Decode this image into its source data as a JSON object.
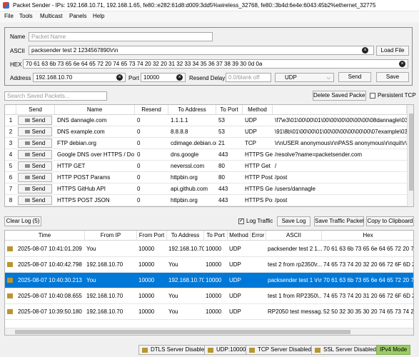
{
  "window": {
    "title": "Packet Sender - IPs: 192.168.10.71, 192.168.1.65, fe80::e282:61d8:d009:3dd5%wireless_32768, fe80::3b4d:6e4e:6043:45b2%ethernet_32775"
  },
  "menu": [
    "File",
    "Tools",
    "Multicast",
    "Panels",
    "Help"
  ],
  "packet": {
    "name_label": "Name",
    "name_placeholder": "Packet Name",
    "ascii_label": "ASCII",
    "ascii_value": "packsender test 2 1234567890\\r\\n",
    "load_file": "Load File",
    "hex_label": "HEX",
    "hex_value": "70 61 63 6b 73 65 6e 64 65 72 20 74 65 73 74 20 32 20 31 32 33 34 35 36 37 38 39 30 0d 0a",
    "address_label": "Address",
    "address_value": "192.168.10.70",
    "port_label": "Port",
    "port_value": "10000",
    "resend_label": "Resend Delay",
    "resend_placeholder": "0.0/blank off",
    "protocol": "UDP",
    "send": "Send",
    "save": "Save"
  },
  "saved": {
    "search_placeholder": "Search Saved Packets...",
    "delete_button": "Delete Saved Packet",
    "persistent_tcp": "Persistent TCP",
    "columns": [
      "Send",
      "Name",
      "Resend",
      "To Address",
      "To Port",
      "Method"
    ],
    "rows": [
      {
        "num": "1",
        "send": "Send",
        "name": "DNS dannagle.com",
        "resend": "0",
        "addr": "1.1.1.1",
        "port": "53",
        "method": "UDP",
        "extra": "\\f7\\e3\\01\\00\\00\\01\\00\\00\\00\\00\\00\\00\\08dannagle\\03com"
      },
      {
        "num": "2",
        "send": "Send",
        "name": "DNS example.com",
        "resend": "0",
        "addr": "8.8.8.8",
        "port": "53",
        "method": "UDP",
        "extra": "\\91\\8b\\01\\00\\00\\01\\00\\00\\00\\00\\00\\00\\07example\\03com"
      },
      {
        "num": "3",
        "send": "Send",
        "name": "FTP debian.org",
        "resend": "0",
        "addr": "cdimage.debian.org",
        "port": "21",
        "method": "TCP",
        "extra": "\\r\\nUSER anonymous\\r\\nPASS anonymous\\r\\nquit\\r\\n"
      },
      {
        "num": "4",
        "send": "Send",
        "name": "Google DNS over HTTPS / DoH",
        "resend": "0",
        "addr": "dns.google",
        "port": "443",
        "method": "HTTPS Get",
        "extra": "/resolve?name=packetsender.com"
      },
      {
        "num": "5",
        "send": "Send",
        "name": "HTTP GET",
        "resend": "0",
        "addr": "neverssl.com",
        "port": "80",
        "method": "HTTP Get",
        "extra": "/"
      },
      {
        "num": "6",
        "send": "Send",
        "name": "HTTP POST Params",
        "resend": "0",
        "addr": "httpbin.org",
        "port": "80",
        "method": "HTTP Post",
        "extra": "/post"
      },
      {
        "num": "7",
        "send": "Send",
        "name": "HTTPS GitHub API",
        "resend": "0",
        "addr": "api.github.com",
        "port": "443",
        "method": "HTTPS Get",
        "extra": "/users/dannagle"
      },
      {
        "num": "8",
        "send": "Send",
        "name": "HTTPS POST JSON",
        "resend": "0",
        "addr": "httpbin.org",
        "port": "443",
        "method": "HTTPS Post",
        "extra": "/post"
      }
    ]
  },
  "log": {
    "clear_log": "Clear Log (5)",
    "log_traffic": "Log Traffic",
    "save_log": "Save Log",
    "save_traffic": "Save Traffic Packet",
    "copy_clipboard": "Copy to Clipboard",
    "columns": [
      "Time",
      "From IP",
      "From Port",
      "To Address",
      "To Port",
      "Method",
      "Error",
      "ASCII",
      "Hex"
    ],
    "rows": [
      {
        "time": "2025-08-07 10:41:01.209",
        "from_ip": "You",
        "from_port": "10000",
        "to_addr": "192.168.10.70",
        "to_port": "10000",
        "method": "UDP",
        "error": "",
        "ascii": "packsender test 2 1...",
        "hex": "70 61 63 6b 73 65 6e 64 65 72 20 74 65"
      },
      {
        "time": "2025-08-07 10:40:42.798",
        "from_ip": "192.168.10.70",
        "from_port": "10000",
        "to_addr": "You",
        "to_port": "10000",
        "method": "UDP",
        "error": "",
        "ascii": "test 2 from rp2350\\r...",
        "hex": "74 65 73 74 20 32 20 66 72 6F 6D 20 72"
      },
      {
        "time": "2025-08-07 10:40:30.213",
        "from_ip": "You",
        "from_port": "10000",
        "to_addr": "192.168.10.70",
        "to_port": "10000",
        "method": "UDP",
        "error": "",
        "ascii": "packsender test 1 \\r\\n",
        "hex": "70 61 63 6b 73 65 6e 64 65 72 20 74 65"
      },
      {
        "time": "2025-08-07 10:40:08.655",
        "from_ip": "192.168.10.70",
        "from_port": "10000",
        "to_addr": "You",
        "to_port": "10000",
        "method": "UDP",
        "error": "",
        "ascii": "test 1 from RP2350\\...",
        "hex": "74 65 73 74 20 31 20 66 72 6F 6D 20 52"
      },
      {
        "time": "2025-08-07 10:39:50.180",
        "from_ip": "192.168.10.70",
        "from_port": "10000",
        "to_addr": "You",
        "to_port": "10000",
        "method": "UDP",
        "error": "",
        "ascii": "RP2050 test messag...",
        "hex": "52 50 32 30 35 30 20 74 65 73 74 20 6D"
      }
    ]
  },
  "status": {
    "dtls": "DTLS Server Disabled",
    "udp": "UDP:10000",
    "tcp": "TCP Server Disabled",
    "ssl": "SSL Server Disabled",
    "ipv4": "IPv4 Mode"
  },
  "colors": {
    "selection": "#0078d7",
    "ipv4_bg": "#9ccc65",
    "clear_icon": "#222222"
  }
}
